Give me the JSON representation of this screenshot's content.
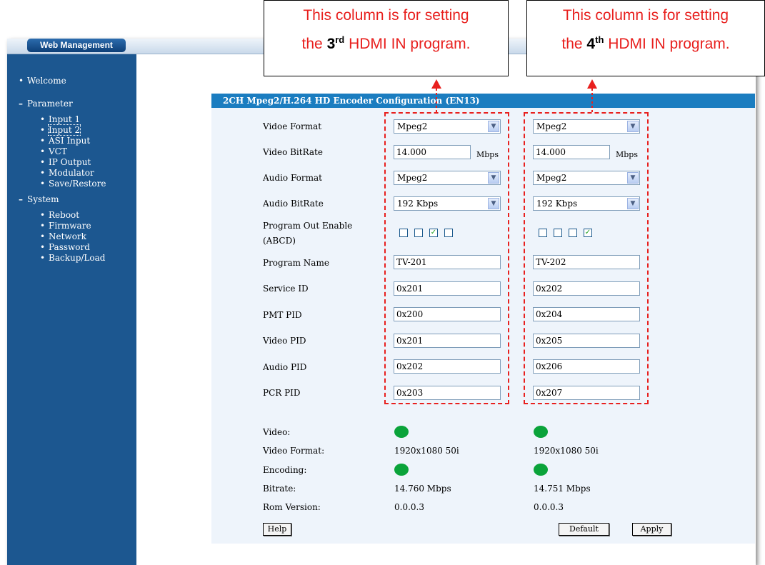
{
  "app": {
    "tab_title": "Web Management"
  },
  "sidebar": {
    "items": [
      {
        "bullet": "•",
        "label": "Welcome",
        "sub": false
      },
      {
        "bullet": "–",
        "label": "Parameter",
        "sub": false
      },
      {
        "bullet": "•",
        "label": "Input 1",
        "sub": true
      },
      {
        "bullet": "•",
        "label": "Input 2",
        "sub": true,
        "selected": true
      },
      {
        "bullet": "•",
        "label": "ASI Input",
        "sub": true
      },
      {
        "bullet": "•",
        "label": "VCT",
        "sub": true
      },
      {
        "bullet": "•",
        "label": "IP Output",
        "sub": true
      },
      {
        "bullet": "•",
        "label": "Modulator",
        "sub": true
      },
      {
        "bullet": "•",
        "label": "Save/Restore",
        "sub": true
      },
      {
        "bullet": "–",
        "label": "System",
        "sub": false
      },
      {
        "bullet": "•",
        "label": "Reboot",
        "sub": true
      },
      {
        "bullet": "•",
        "label": "Firmware",
        "sub": true
      },
      {
        "bullet": "•",
        "label": "Network",
        "sub": true
      },
      {
        "bullet": "•",
        "label": "Password",
        "sub": true
      },
      {
        "bullet": "•",
        "label": "Backup/Load",
        "sub": true
      }
    ]
  },
  "panel": {
    "title": "2CH Mpeg2/H.264 HD Encoder Configuration (EN13)",
    "labels": {
      "video_format": "Vidoe Format",
      "video_bitrate": "Video BitRate",
      "audio_format": "Audio Format",
      "audio_bitrate": "Audio BitRate",
      "program_out_1": "Program Out Enable",
      "program_out_2": "(ABCD)",
      "program_name": "Program Name",
      "service_id": "Service ID",
      "pmt_pid": "PMT PID",
      "video_pid": "Video PID",
      "audio_pid": "Audio PID",
      "pcr_pid": "PCR PID",
      "status_video": "Video:",
      "status_video_format": "Video Format:",
      "status_encoding": "Encoding:",
      "status_bitrate": "Bitrate:",
      "status_rom": "Rom Version:"
    },
    "columns": [
      {
        "video_format": "Mpeg2",
        "video_bitrate": "14.000",
        "bitrate_unit": "Mbps",
        "audio_format": "Mpeg2",
        "audio_bitrate": "192 Kbps",
        "program_out": [
          false,
          false,
          true,
          false
        ],
        "program_name": "TV-201",
        "service_id": "0x201",
        "pmt_pid": "0x200",
        "video_pid": "0x201",
        "audio_pid": "0x202",
        "pcr_pid": "0x203",
        "status_video_format": "1920x1080 50i",
        "status_bitrate": "14.760 Mbps",
        "status_rom": "0.0.0.3"
      },
      {
        "video_format": "Mpeg2",
        "video_bitrate": "14.000",
        "bitrate_unit": "Mbps",
        "audio_format": "Mpeg2",
        "audio_bitrate": "192 Kbps",
        "program_out": [
          false,
          false,
          false,
          true
        ],
        "program_name": "TV-202",
        "service_id": "0x202",
        "pmt_pid": "0x204",
        "video_pid": "0x205",
        "audio_pid": "0x206",
        "pcr_pid": "0x207",
        "status_video_format": "1920x1080 50i",
        "status_bitrate": "14.751 Mbps",
        "status_rom": "0.0.0.3"
      }
    ],
    "buttons": {
      "help": "Help",
      "default": "Default",
      "apply": "Apply"
    },
    "status_color": "#0aa33a"
  },
  "callouts": [
    {
      "line1": "This column is for setting",
      "line2_pre": "the ",
      "ordinal_num": "3",
      "ordinal_suffix": "rd",
      "line2_post": " HDMI IN program."
    },
    {
      "line1": "This column is for setting",
      "line2_pre": "the ",
      "ordinal_num": "4",
      "ordinal_suffix": "th",
      "line2_post": " HDMI IN program."
    }
  ],
  "annotation_color": "#e8201e"
}
